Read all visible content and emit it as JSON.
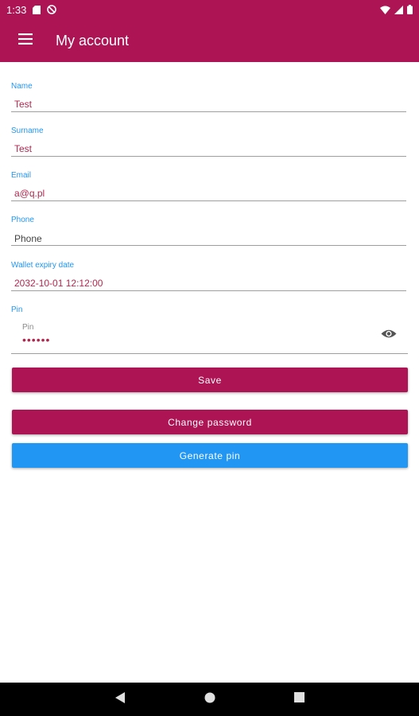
{
  "status_bar": {
    "time": "1:33",
    "icons": [
      "sd-card-icon",
      "no-disturb-icon",
      "wifi-icon",
      "signal-icon",
      "battery-icon"
    ]
  },
  "app_bar": {
    "title": "My account",
    "menu_icon": "hamburger-menu-icon"
  },
  "form": {
    "name": {
      "label": "Name",
      "value": "Test"
    },
    "surname": {
      "label": "Surname",
      "value": "Test"
    },
    "email": {
      "label": "Email",
      "value": "a@q.pl"
    },
    "phone": {
      "label": "Phone",
      "value": "Phone"
    },
    "wallet_expiry": {
      "label": "Wallet expiry date",
      "value": "2032-10-01 12:12:00"
    },
    "pin": {
      "label": "Pin",
      "hint": "Pin",
      "value": "••••••",
      "toggle_icon": "eye-icon"
    }
  },
  "buttons": {
    "save": "Save",
    "change_password": "Change password",
    "generate_pin": "Generate pin"
  },
  "nav_bar": {
    "icons": [
      "back-icon",
      "home-icon",
      "recents-icon"
    ]
  },
  "colors": {
    "primary": "#ac1454",
    "accent": "#2196f3",
    "label": "#2196f3",
    "value": "#b0284e"
  }
}
